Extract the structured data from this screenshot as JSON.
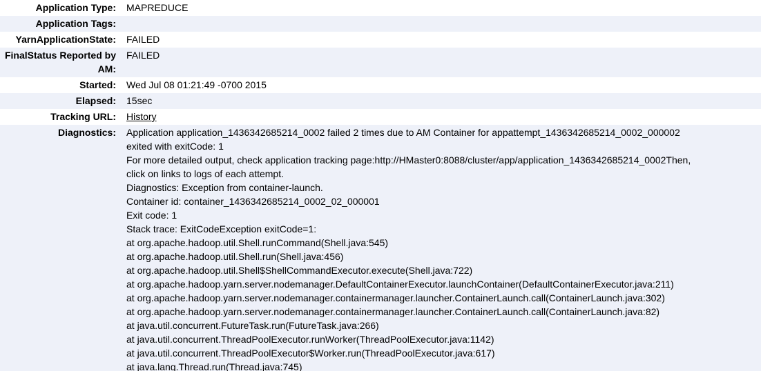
{
  "rows": [
    {
      "label": "Application Type:",
      "value": "MAPREDUCE"
    },
    {
      "label": "Application Tags:",
      "value": ""
    },
    {
      "label": "YarnApplicationState:",
      "value": "FAILED"
    },
    {
      "label": "FinalStatus Reported by AM:",
      "value": "FAILED"
    },
    {
      "label": "Started:",
      "value": "Wed Jul 08 01:21:49 -0700 2015"
    },
    {
      "label": "Elapsed:",
      "value": "15sec"
    },
    {
      "label": "Tracking URL:",
      "value": "History"
    },
    {
      "label": "Diagnostics:",
      "value": ""
    }
  ],
  "diagnostics": [
    "Application application_1436342685214_0002 failed 2 times due to AM Container for appattempt_1436342685214_0002_000002",
    "exited with exitCode: 1",
    "For more detailed output, check application tracking page:http://HMaster0:8088/cluster/app/application_1436342685214_0002Then,",
    "click on links to logs of each attempt.",
    "Diagnostics: Exception from container-launch.",
    "Container id: container_1436342685214_0002_02_000001",
    "Exit code: 1",
    "Stack trace: ExitCodeException exitCode=1:",
    "at org.apache.hadoop.util.Shell.runCommand(Shell.java:545)",
    "at org.apache.hadoop.util.Shell.run(Shell.java:456)",
    "at org.apache.hadoop.util.Shell$ShellCommandExecutor.execute(Shell.java:722)",
    "at org.apache.hadoop.yarn.server.nodemanager.DefaultContainerExecutor.launchContainer(DefaultContainerExecutor.java:211)",
    "at org.apache.hadoop.yarn.server.nodemanager.containermanager.launcher.ContainerLaunch.call(ContainerLaunch.java:302)",
    "at org.apache.hadoop.yarn.server.nodemanager.containermanager.launcher.ContainerLaunch.call(ContainerLaunch.java:82)",
    "at java.util.concurrent.FutureTask.run(FutureTask.java:266)",
    "at java.util.concurrent.ThreadPoolExecutor.runWorker(ThreadPoolExecutor.java:1142)",
    "at java.util.concurrent.ThreadPoolExecutor$Worker.run(ThreadPoolExecutor.java:617)",
    "at java.lang.Thread.run(Thread.java:745)"
  ]
}
